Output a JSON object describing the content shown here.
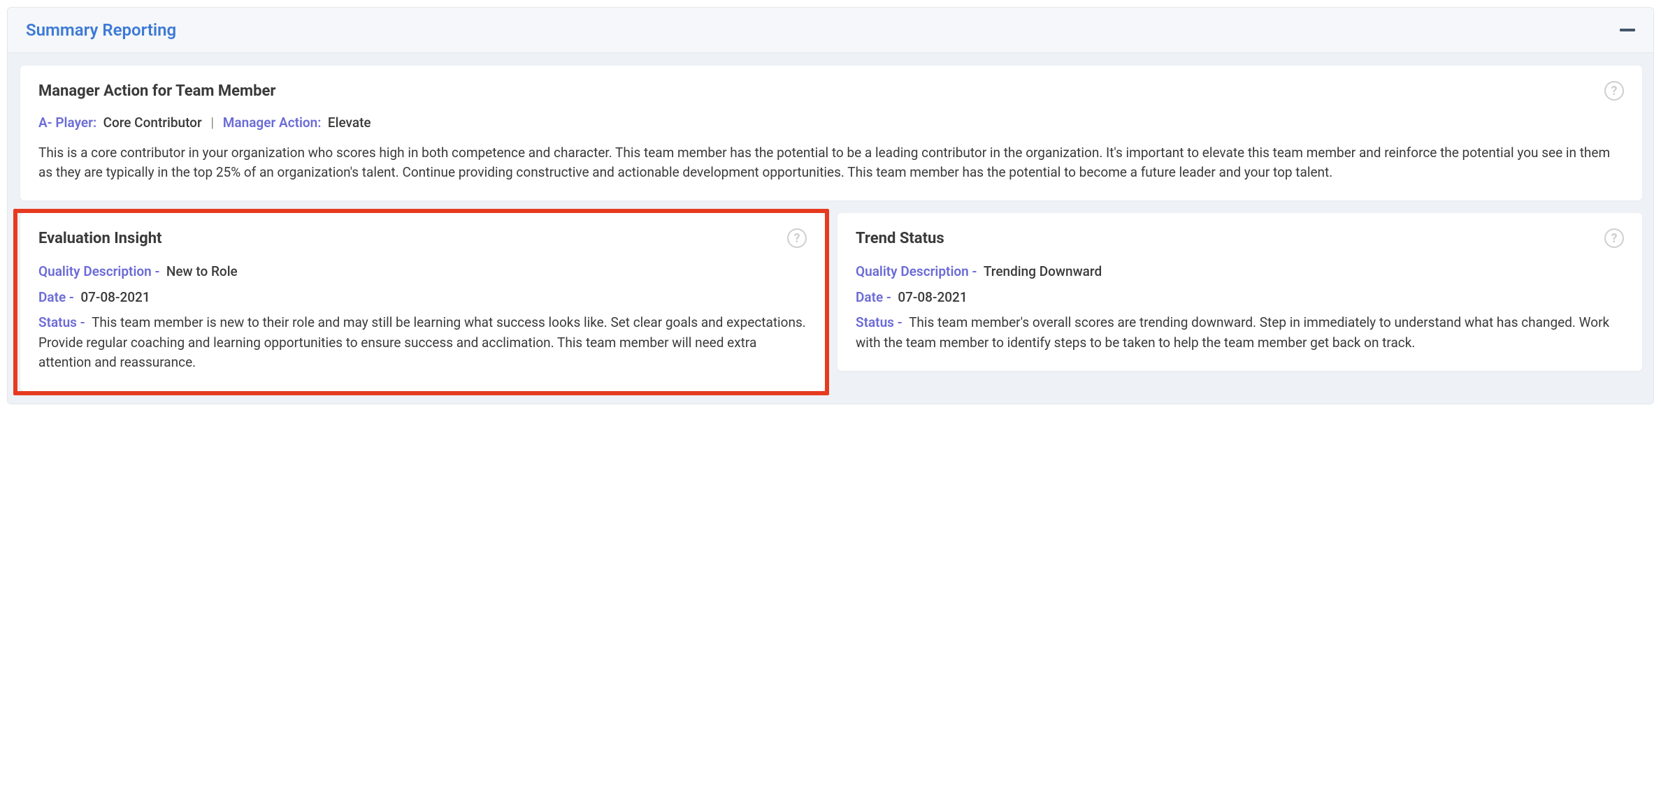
{
  "panel": {
    "title": "Summary Reporting"
  },
  "manager_action": {
    "title": "Manager Action for Team Member",
    "player_label": "A- Player:",
    "player_value": "Core Contributor",
    "action_label": "Manager Action:",
    "action_value": "Elevate",
    "body": "This is a core contributor in your organization who scores high in both competence and character. This team member has the potential to be a leading contributor in the organization. It's important to elevate this team member and reinforce the potential you see in them as they are typically in the top 25% of an organization's talent. Continue providing constructive and actionable development opportunities. This team member has the potential to become a future leader and your top talent."
  },
  "evaluation_insight": {
    "title": "Evaluation Insight",
    "quality_label": "Quality Description -",
    "quality_value": "New to Role",
    "date_label": "Date -",
    "date_value": "07-08-2021",
    "status_label": "Status -",
    "status_value": "This team member is new to their role and may still be learning what success looks like. Set clear goals and expectations. Provide regular coaching and learning opportunities to ensure success and acclimation. This team member will need extra attention and reassurance."
  },
  "trend_status": {
    "title": "Trend Status",
    "quality_label": "Quality Description -",
    "quality_value": "Trending Downward",
    "date_label": "Date -",
    "date_value": "07-08-2021",
    "status_label": "Status -",
    "status_value": "This team member's overall scores are trending downward. Step in immediately to understand what has changed. Work with the team member to identify steps to be taken to help the team member get back on track."
  }
}
